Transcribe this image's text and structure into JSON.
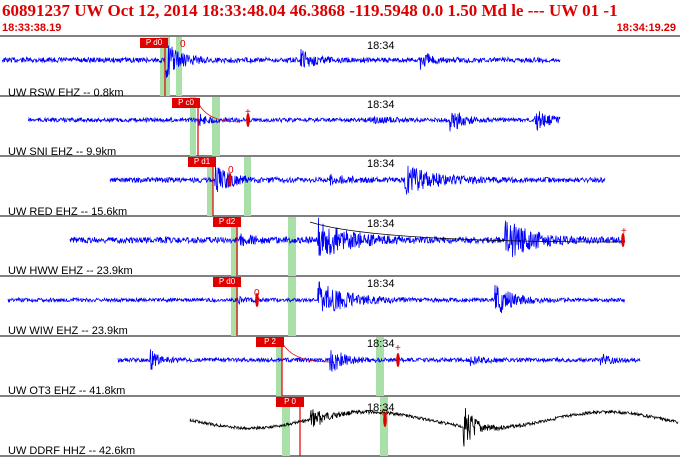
{
  "header": {
    "event_line": "60891237 UW Oct 12, 2014 18:33:48.04   46.3868 -119.5948  0.0 1.50 Md le --- UW 01  -1",
    "time_start": "18:33:38.19",
    "time_end": "18:34:19.29"
  },
  "colors": {
    "trace_blue": "#0000ff",
    "trace_black": "#000000",
    "pick_red": "#e00000",
    "window_green": "#a8e0a8",
    "header_red": "#dd0000"
  },
  "traces": [
    {
      "label": "UW RSW EHZ -- 0.8km",
      "minute": "18:34",
      "pick": "P d0",
      "mark": "0",
      "color": "blue"
    },
    {
      "label": "UW SNI EHZ -- 9.9km",
      "minute": "18:34",
      "pick": "P c0",
      "mark": "+",
      "color": "blue"
    },
    {
      "label": "UW RED EHZ -- 15.6km",
      "minute": "18:34",
      "pick": "P d1",
      "mark": "0",
      "color": "blue"
    },
    {
      "label": "UW HWW EHZ -- 23.9km",
      "minute": "18:34",
      "pick": "P d2",
      "mark": "+",
      "color": "blue"
    },
    {
      "label": "UW WIW EHZ -- 23.9km",
      "minute": "18:34",
      "pick": "P d0",
      "mark": "0",
      "color": "blue"
    },
    {
      "label": "UW OT3 EHZ -- 41.8km",
      "minute": "18:34",
      "pick": "P 2",
      "mark": "+",
      "color": "blue"
    },
    {
      "label": "UW DDRF HHZ -- 42.6km",
      "minute": "18:34",
      "pick": "P 0",
      "mark": "0",
      "color": "black"
    }
  ]
}
